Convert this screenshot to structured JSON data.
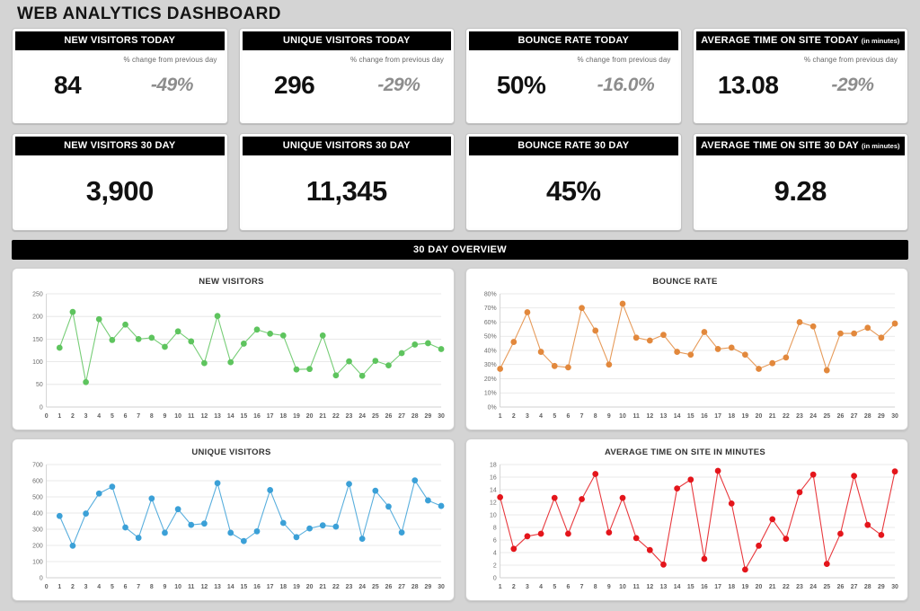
{
  "header": {
    "title": "WEB ANALYTICS DASHBOARD"
  },
  "kpi_today": {
    "change_label": "% change from previous day",
    "cards": [
      {
        "title": "NEW VISITORS TODAY",
        "suffix": "",
        "value": "84",
        "delta": "-49%"
      },
      {
        "title": "UNIQUE VISITORS TODAY",
        "suffix": "",
        "value": "296",
        "delta": "-29%"
      },
      {
        "title": "BOUNCE RATE TODAY",
        "suffix": "",
        "value": "50%",
        "delta": "-16.0%"
      },
      {
        "title": "AVERAGE TIME ON SITE TODAY",
        "suffix": "(in minutes)",
        "value": "13.08",
        "delta": "-29%"
      }
    ]
  },
  "kpi_30day": {
    "cards": [
      {
        "title": "NEW VISITORS 30 DAY",
        "suffix": "",
        "value": "3,900"
      },
      {
        "title": "UNIQUE VISITORS 30 DAY",
        "suffix": "",
        "value": "11,345"
      },
      {
        "title": "BOUNCE RATE 30 DAY",
        "suffix": "",
        "value": "45%"
      },
      {
        "title": "AVERAGE TIME ON SITE 30 DAY",
        "suffix": "(in minutes)",
        "value": "9.28"
      }
    ]
  },
  "section": {
    "overview_banner": "30 DAY OVERVIEW"
  },
  "colors": {
    "green": "#5ec45e",
    "orange": "#e2883c",
    "blue": "#3ba0d7",
    "red": "#e4151b",
    "banner_bg": "#000000",
    "page_bg": "#d4d4d4"
  },
  "chart_data": [
    {
      "type": "line",
      "title": "NEW VISITORS",
      "xlabel": "",
      "ylabel": "",
      "color": "#5ec45e",
      "grid": true,
      "legend": "none",
      "x": [
        1,
        2,
        3,
        4,
        5,
        6,
        7,
        8,
        9,
        10,
        11,
        12,
        13,
        14,
        15,
        16,
        17,
        18,
        19,
        20,
        21,
        22,
        23,
        24,
        25,
        26,
        27,
        28,
        29,
        30
      ],
      "xticklabels": [
        "0",
        "1",
        "2",
        "3",
        "4",
        "5",
        "6",
        "7",
        "8",
        "9",
        "10",
        "11",
        "12",
        "13",
        "14",
        "15",
        "16",
        "17",
        "18",
        "19",
        "20",
        "21",
        "22",
        "23",
        "24",
        "25",
        "26",
        "27",
        "28",
        "29",
        "30"
      ],
      "yticklabels": [
        "0",
        "50",
        "100",
        "150",
        "200",
        "250"
      ],
      "ylim": [
        0,
        250
      ],
      "xlim": [
        0,
        30
      ],
      "values": [
        131,
        210,
        55,
        194,
        148,
        182,
        150,
        153,
        133,
        167,
        145,
        97,
        201,
        99,
        140,
        171,
        162,
        158,
        83,
        84,
        158,
        70,
        101,
        69,
        102,
        92,
        119,
        138,
        141,
        128
      ]
    },
    {
      "type": "line",
      "title": "BOUNCE RATE",
      "xlabel": "",
      "ylabel": "",
      "color": "#e2883c",
      "grid": true,
      "legend": "none",
      "x": [
        1,
        2,
        3,
        4,
        5,
        6,
        7,
        8,
        9,
        10,
        11,
        12,
        13,
        14,
        15,
        16,
        17,
        18,
        19,
        20,
        21,
        22,
        23,
        24,
        25,
        26,
        27,
        28,
        29,
        30
      ],
      "xticklabels": [
        "1",
        "2",
        "3",
        "4",
        "5",
        "6",
        "7",
        "8",
        "9",
        "10",
        "11",
        "12",
        "13",
        "14",
        "15",
        "16",
        "17",
        "18",
        "19",
        "20",
        "21",
        "22",
        "23",
        "24",
        "25",
        "26",
        "27",
        "28",
        "29",
        "30"
      ],
      "yticklabels": [
        "0%",
        "10%",
        "20%",
        "30%",
        "40%",
        "50%",
        "60%",
        "70%",
        "80%"
      ],
      "ylim": [
        0,
        80
      ],
      "xlim": [
        1,
        30
      ],
      "values": [
        27,
        46,
        67,
        39,
        29,
        28,
        70,
        54,
        30,
        73,
        49,
        47,
        51,
        39,
        37,
        53,
        41,
        42,
        37,
        27,
        31,
        35,
        60,
        57,
        26,
        52,
        52,
        56,
        49,
        59
      ]
    },
    {
      "type": "line",
      "title": "UNIQUE VISITORS",
      "xlabel": "",
      "ylabel": "",
      "color": "#3ba0d7",
      "grid": true,
      "legend": "none",
      "x": [
        1,
        2,
        3,
        4,
        5,
        6,
        7,
        8,
        9,
        10,
        11,
        12,
        13,
        14,
        15,
        16,
        17,
        18,
        19,
        20,
        21,
        22,
        23,
        24,
        25,
        26,
        27,
        28,
        29,
        30
      ],
      "xticklabels": [
        "0",
        "1",
        "2",
        "3",
        "4",
        "5",
        "6",
        "7",
        "8",
        "9",
        "10",
        "11",
        "12",
        "13",
        "14",
        "15",
        "16",
        "17",
        "18",
        "19",
        "20",
        "21",
        "22",
        "23",
        "24",
        "25",
        "26",
        "27",
        "28",
        "29",
        "30"
      ],
      "yticklabels": [
        "0",
        "100",
        "200",
        "300",
        "400",
        "500",
        "600",
        "700"
      ],
      "ylim": [
        0,
        700
      ],
      "xlim": [
        0,
        30
      ],
      "values": [
        382,
        198,
        397,
        521,
        563,
        311,
        247,
        490,
        278,
        424,
        327,
        335,
        585,
        278,
        227,
        287,
        542,
        339,
        251,
        305,
        324,
        316,
        580,
        241,
        538,
        440,
        280,
        602,
        478,
        444
      ]
    },
    {
      "type": "line",
      "title": "AVERAGE TIME ON SITE IN MINUTES",
      "xlabel": "",
      "ylabel": "",
      "color": "#e4151b",
      "grid": true,
      "legend": "none",
      "x": [
        1,
        2,
        3,
        4,
        5,
        6,
        7,
        8,
        9,
        10,
        11,
        12,
        13,
        14,
        15,
        16,
        17,
        18,
        19,
        20,
        21,
        22,
        23,
        24,
        25,
        26,
        27,
        28,
        29,
        30
      ],
      "xticklabels": [
        "1",
        "2",
        "3",
        "4",
        "5",
        "6",
        "7",
        "8",
        "9",
        "10",
        "11",
        "12",
        "13",
        "14",
        "15",
        "16",
        "17",
        "18",
        "19",
        "20",
        "21",
        "22",
        "23",
        "24",
        "25",
        "26",
        "27",
        "28",
        "29",
        "30"
      ],
      "yticklabels": [
        "0",
        "2",
        "4",
        "6",
        "8",
        "10",
        "12",
        "14",
        "16",
        "18"
      ],
      "ylim": [
        0,
        18
      ],
      "xlim": [
        1,
        30
      ],
      "values": [
        12.8,
        4.6,
        6.6,
        7.0,
        12.7,
        7.0,
        12.5,
        16.5,
        7.2,
        12.7,
        6.3,
        4.4,
        2.1,
        14.2,
        15.6,
        3.0,
        17.0,
        11.8,
        1.3,
        5.1,
        9.3,
        6.2,
        13.6,
        16.4,
        2.2,
        7.0,
        16.2,
        8.4,
        6.8,
        16.9
      ]
    }
  ]
}
